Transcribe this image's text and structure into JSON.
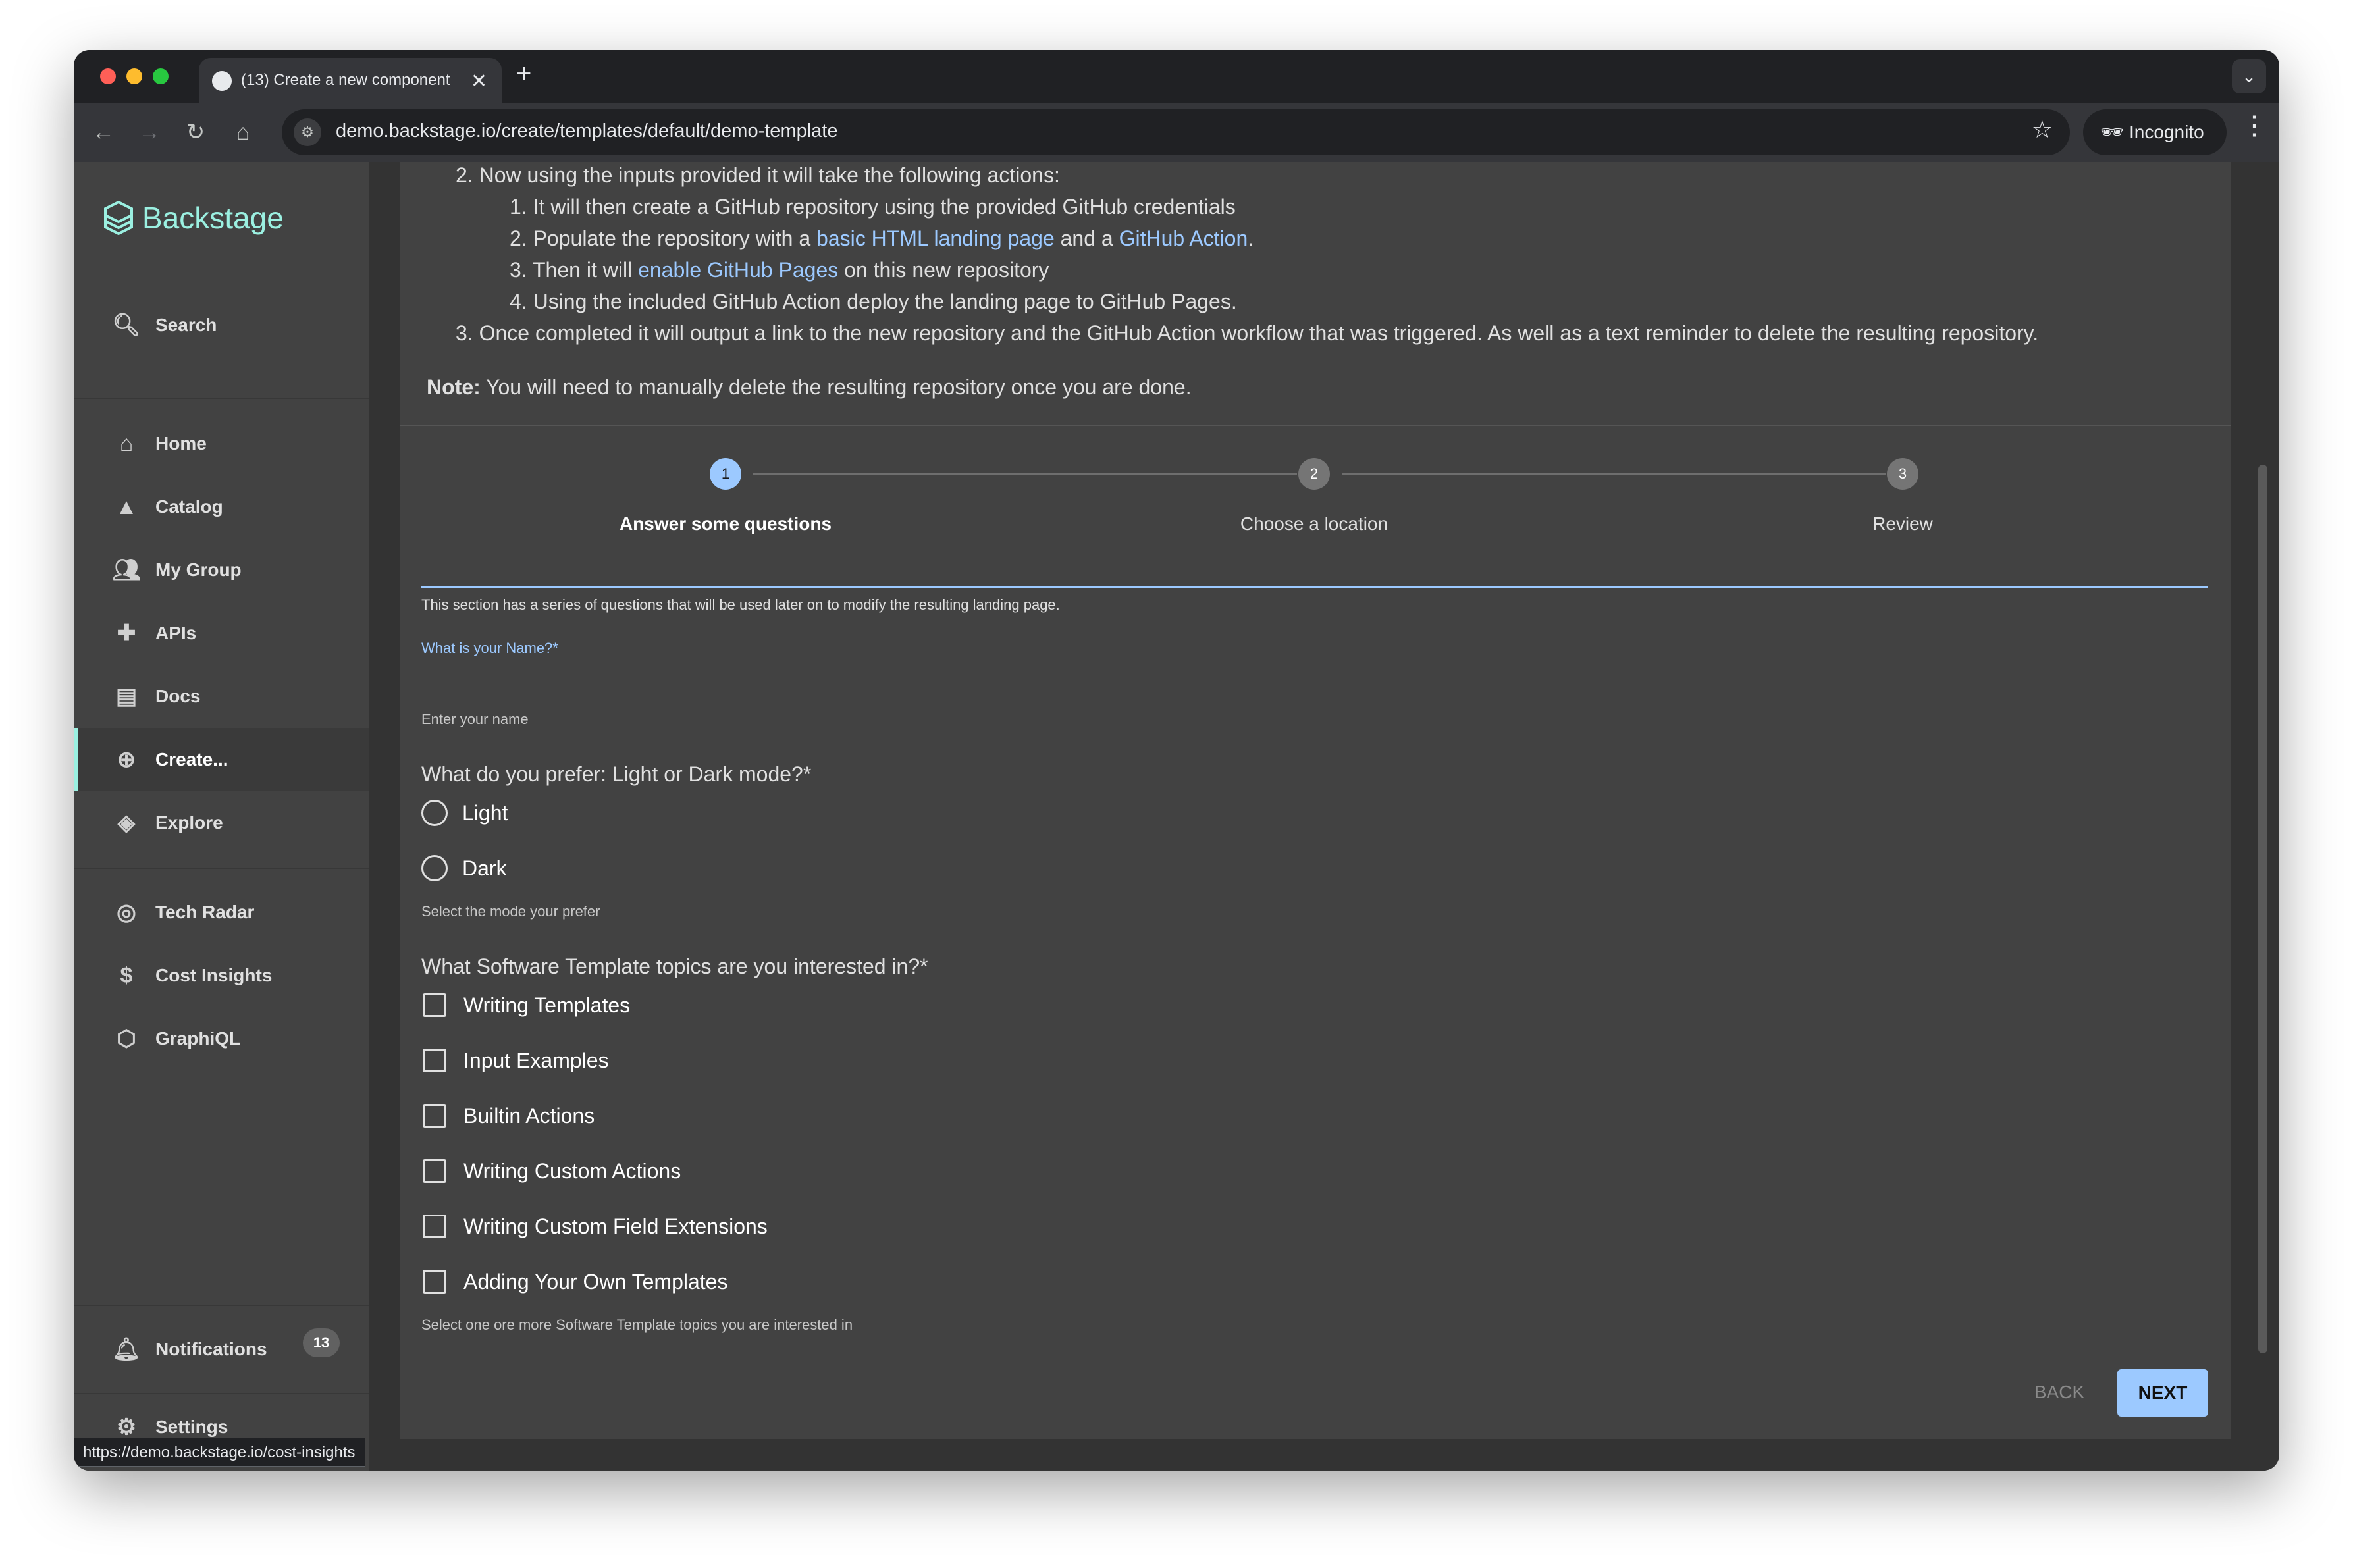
{
  "browser": {
    "tab_title": "(13) Create a new component",
    "url": "demo.backstage.io/create/templates/default/demo-template",
    "incognito_label": "Incognito",
    "status_url": "https://demo.backstage.io/cost-insights"
  },
  "sidebar": {
    "brand": "Backstage",
    "search_label": "Search",
    "items": [
      {
        "label": "Home",
        "icon": "home-icon"
      },
      {
        "label": "Catalog",
        "icon": "catalog-icon"
      },
      {
        "label": "My Group",
        "icon": "group-icon"
      },
      {
        "label": "APIs",
        "icon": "puzzle-icon"
      },
      {
        "label": "Docs",
        "icon": "docs-icon"
      },
      {
        "label": "Create...",
        "icon": "create-icon"
      },
      {
        "label": "Explore",
        "icon": "explore-icon"
      }
    ],
    "plugins": [
      {
        "label": "Tech Radar",
        "icon": "radar-icon"
      },
      {
        "label": "Cost Insights",
        "icon": "dollar-icon"
      },
      {
        "label": "GraphiQL",
        "icon": "graphiql-icon"
      }
    ],
    "notifications_label": "Notifications",
    "notifications_count": "13",
    "settings_label": "Settings"
  },
  "description": {
    "line2_num": "2.",
    "line2": "Now using the inputs provided it will take the following actions:",
    "sub1_num": "1.",
    "sub1": "It will then create a GitHub repository using the provided GitHub credentials",
    "sub2_num": "2.",
    "sub2_a": "Populate the repository with a ",
    "sub2_link1": "basic HTML landing page",
    "sub2_b": " and a ",
    "sub2_link2": "GitHub Action",
    "sub2_c": ".",
    "sub3_num": "3.",
    "sub3_a": "Then it will ",
    "sub3_link": "enable GitHub Pages",
    "sub3_b": " on this new repository",
    "sub4_num": "4.",
    "sub4": "Using the included GitHub Action deploy the landing page to GitHub Pages.",
    "line3_num": "3.",
    "line3": "Once completed it will output a link to the new repository and the GitHub Action workflow that was triggered. As well as a text reminder to delete the resulting repository.",
    "note_label": "Note:",
    "note_text": " You will need to manually delete the resulting repository once you are done."
  },
  "stepper": {
    "steps": [
      {
        "num": "1",
        "label": "Answer some questions",
        "active": true
      },
      {
        "num": "2",
        "label": "Choose a location",
        "active": false
      },
      {
        "num": "3",
        "label": "Review",
        "active": false
      }
    ]
  },
  "form": {
    "section_text": "This section has a series of questions that will be used later on to modify the resulting landing page.",
    "name_label": "What is your Name?*",
    "name_value": "",
    "name_helper": "Enter your name",
    "mode_question": "What do you prefer: Light or Dark mode?*",
    "mode_options": [
      "Light",
      "Dark"
    ],
    "mode_helper": "Select the mode your prefer",
    "topics_question": "What Software Template topics are you interested in?*",
    "topics": [
      "Writing Templates",
      "Input Examples",
      "Builtin Actions",
      "Writing Custom Actions",
      "Writing Custom Field Extensions",
      "Adding Your Own Templates"
    ],
    "topics_helper": "Select one ore more Software Template topics you are interested in",
    "back_label": "BACK",
    "next_label": "NEXT"
  },
  "colors": {
    "accent": "#9cc9ff",
    "brand": "#9bf0e1",
    "step_active": "#9cc9ff",
    "step_inactive": "#757575"
  }
}
